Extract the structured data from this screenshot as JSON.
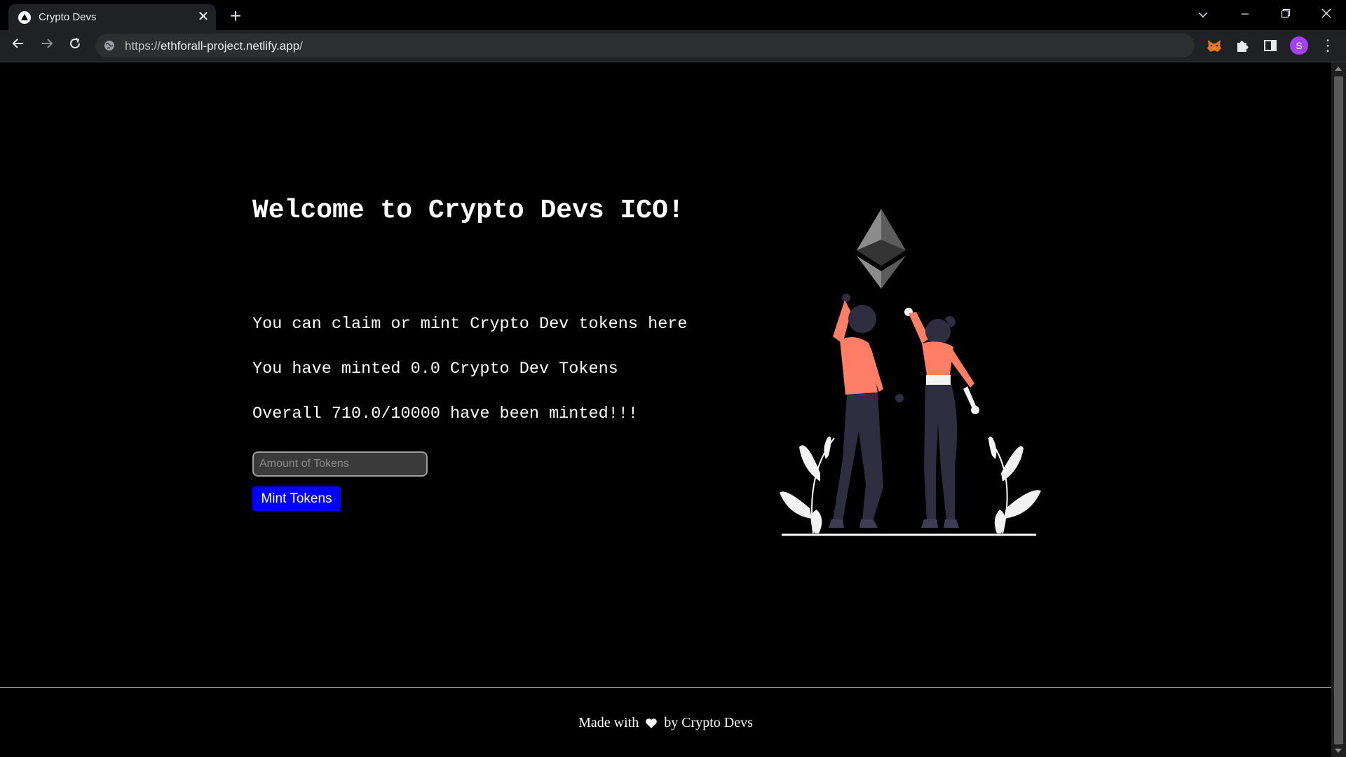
{
  "browser": {
    "tab_title": "Crypto Devs",
    "url_scheme": "https://",
    "url_host": "ethforall-project.netlify.app",
    "url_path": "/",
    "profile_initial": "S"
  },
  "page": {
    "title": "Welcome to Crypto Devs ICO!",
    "intro": "You can claim or mint Crypto Dev tokens here",
    "minted_text": "You have minted 0.0 Crypto Dev Tokens",
    "overall_text": "Overall 710.0/10000 have been minted!!!",
    "amount_placeholder": "Amount of Tokens",
    "mint_button": "Mint Tokens"
  },
  "footer": {
    "before": "Made with",
    "after": "by Crypto Devs"
  },
  "colors": {
    "accent_button": "#0000ff",
    "figure_shirt": "#ff7f66",
    "figure_pants": "#2f2e41",
    "background": "#000000"
  }
}
